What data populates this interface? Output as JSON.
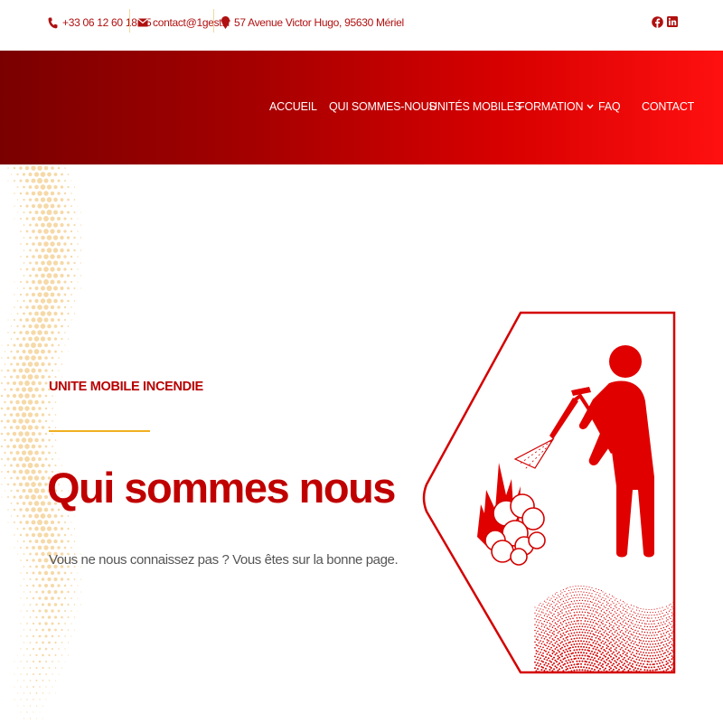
{
  "topbar": {
    "phone": "+33 06 12 60 18 25",
    "email": "contact@1gest.fr",
    "address": "57 Avenue Victor Hugo, 95630 Mériel",
    "social": [
      "facebook-icon",
      "linkedin-icon"
    ]
  },
  "nav": {
    "items": [
      {
        "label": "ACCUEIL"
      },
      {
        "label": "QUI SOMMES-NOUS"
      },
      {
        "label": "UNITÉS MOBILES"
      },
      {
        "label": "FORMATION",
        "dropdown": true
      },
      {
        "label": "FAQ"
      },
      {
        "label": "CONTACT"
      }
    ]
  },
  "hero": {
    "eyebrow": "UNITE MOBILE INCENDIE",
    "title": "Qui sommes nous",
    "subtitle": "Vous ne nous connaissez pas ? Vous êtes sur la bonne page."
  },
  "colors": {
    "brand_red": "#c00000",
    "accent_gold": "#f0b020",
    "header_gradient": [
      "#7a0000",
      "#ff1010"
    ]
  }
}
